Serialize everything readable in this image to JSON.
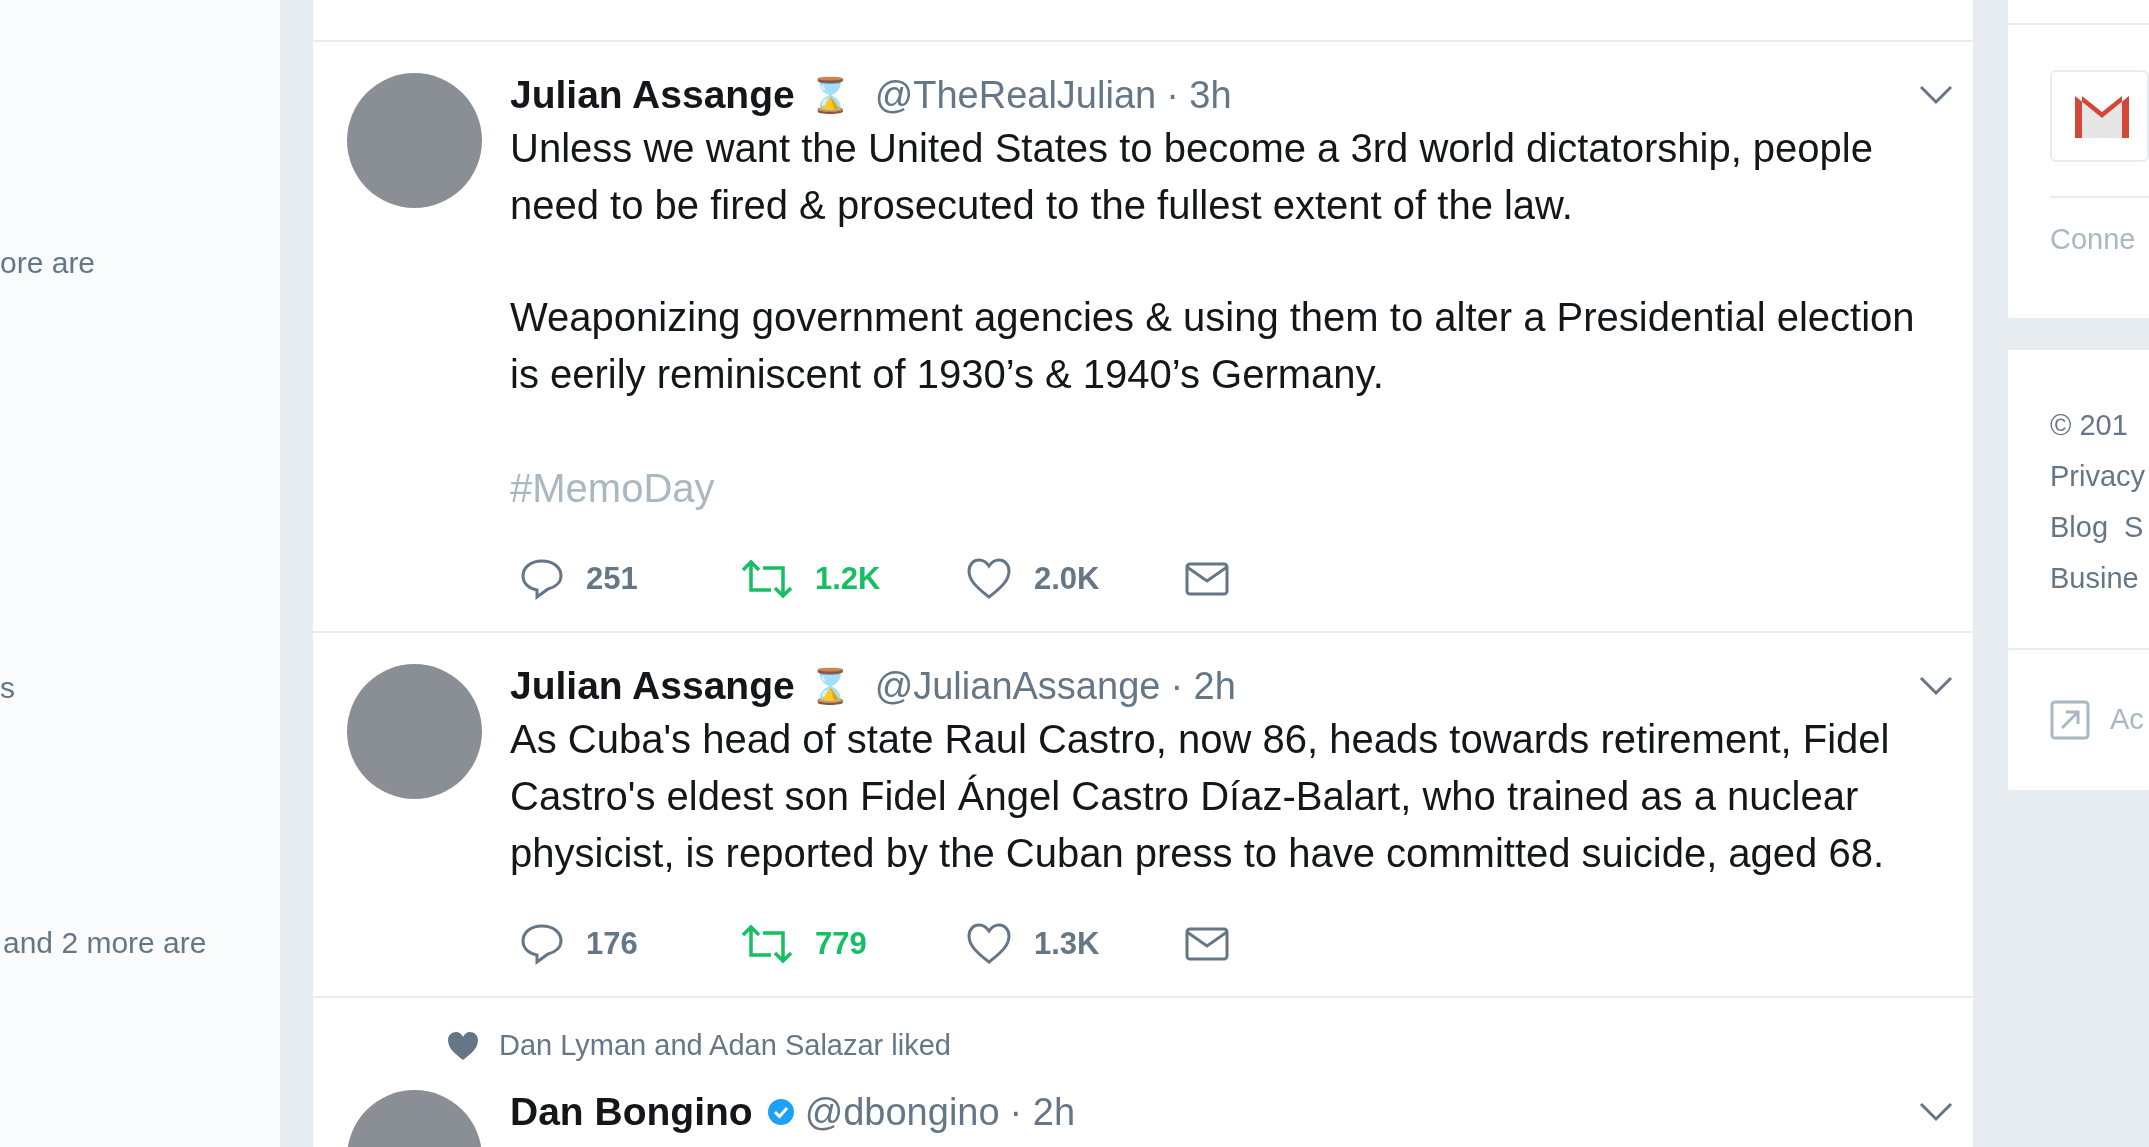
{
  "left_panel": {
    "texts": [
      "ore are",
      "s",
      "and 2 more are"
    ]
  },
  "tweets": [
    {
      "name": "Julian Assange",
      "emoji": "⌛",
      "verified": false,
      "handle": "@TheRealJulian",
      "time": "· 3h",
      "paragraphs": [
        "Unless we want the United States to become a 3rd world dictatorship, people need to be fired & prosecuted to the fullest extent of the law.",
        "Weaponizing government agencies & using them to alter a Presidential election is eerily reminiscent of 1930’s & 1940’s Germany."
      ],
      "hashtag": "#MemoDay",
      "actions": {
        "replies": "251",
        "retweets": "1.2K",
        "retweeted": true,
        "likes": "2.0K"
      }
    },
    {
      "name": "Julian Assange",
      "emoji": "⌛",
      "verified": false,
      "handle": "@JulianAssange",
      "time": "· 2h",
      "paragraphs": [
        "As Cuba's head of state Raul Castro, now 86, heads towards retirement, Fidel Castro's eldest son Fidel Ángel Castro Díaz-Balart, who trained as a nuclear physicist, is reported by the Cuban press to have committed suicide, aged 68."
      ],
      "actions": {
        "replies": "176",
        "retweets": "779",
        "retweeted": true,
        "likes": "1.3K"
      }
    },
    {
      "social_context": "Dan Lyman and Adan Salazar liked",
      "name": "Dan Bongino",
      "verified": true,
      "handle": "@dbongino",
      "time": "· 2h"
    }
  ],
  "right_panel": {
    "connect_text": "Conne",
    "copyright": "© 201",
    "links": [
      "Privacy",
      "Blog",
      "S",
      "Busine"
    ],
    "ads_text": "Ac"
  }
}
